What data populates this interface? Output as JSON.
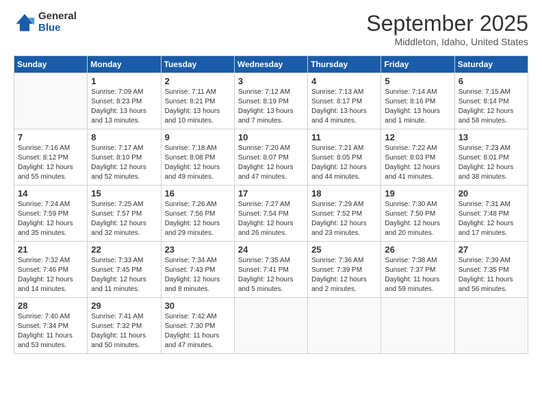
{
  "header": {
    "logo_general": "General",
    "logo_blue": "Blue",
    "month_title": "September 2025",
    "location": "Middleton, Idaho, United States"
  },
  "days_of_week": [
    "Sunday",
    "Monday",
    "Tuesday",
    "Wednesday",
    "Thursday",
    "Friday",
    "Saturday"
  ],
  "weeks": [
    [
      {
        "day": "",
        "info": ""
      },
      {
        "day": "1",
        "info": "Sunrise: 7:09 AM\nSunset: 8:23 PM\nDaylight: 13 hours\nand 13 minutes."
      },
      {
        "day": "2",
        "info": "Sunrise: 7:11 AM\nSunset: 8:21 PM\nDaylight: 13 hours\nand 10 minutes."
      },
      {
        "day": "3",
        "info": "Sunrise: 7:12 AM\nSunset: 8:19 PM\nDaylight: 13 hours\nand 7 minutes."
      },
      {
        "day": "4",
        "info": "Sunrise: 7:13 AM\nSunset: 8:17 PM\nDaylight: 13 hours\nand 4 minutes."
      },
      {
        "day": "5",
        "info": "Sunrise: 7:14 AM\nSunset: 8:16 PM\nDaylight: 13 hours\nand 1 minute."
      },
      {
        "day": "6",
        "info": "Sunrise: 7:15 AM\nSunset: 8:14 PM\nDaylight: 12 hours\nand 58 minutes."
      }
    ],
    [
      {
        "day": "7",
        "info": "Sunrise: 7:16 AM\nSunset: 8:12 PM\nDaylight: 12 hours\nand 55 minutes."
      },
      {
        "day": "8",
        "info": "Sunrise: 7:17 AM\nSunset: 8:10 PM\nDaylight: 12 hours\nand 52 minutes."
      },
      {
        "day": "9",
        "info": "Sunrise: 7:18 AM\nSunset: 8:08 PM\nDaylight: 12 hours\nand 49 minutes."
      },
      {
        "day": "10",
        "info": "Sunrise: 7:20 AM\nSunset: 8:07 PM\nDaylight: 12 hours\nand 47 minutes."
      },
      {
        "day": "11",
        "info": "Sunrise: 7:21 AM\nSunset: 8:05 PM\nDaylight: 12 hours\nand 44 minutes."
      },
      {
        "day": "12",
        "info": "Sunrise: 7:22 AM\nSunset: 8:03 PM\nDaylight: 12 hours\nand 41 minutes."
      },
      {
        "day": "13",
        "info": "Sunrise: 7:23 AM\nSunset: 8:01 PM\nDaylight: 12 hours\nand 38 minutes."
      }
    ],
    [
      {
        "day": "14",
        "info": "Sunrise: 7:24 AM\nSunset: 7:59 PM\nDaylight: 12 hours\nand 35 minutes."
      },
      {
        "day": "15",
        "info": "Sunrise: 7:25 AM\nSunset: 7:57 PM\nDaylight: 12 hours\nand 32 minutes."
      },
      {
        "day": "16",
        "info": "Sunrise: 7:26 AM\nSunset: 7:56 PM\nDaylight: 12 hours\nand 29 minutes."
      },
      {
        "day": "17",
        "info": "Sunrise: 7:27 AM\nSunset: 7:54 PM\nDaylight: 12 hours\nand 26 minutes."
      },
      {
        "day": "18",
        "info": "Sunrise: 7:29 AM\nSunset: 7:52 PM\nDaylight: 12 hours\nand 23 minutes."
      },
      {
        "day": "19",
        "info": "Sunrise: 7:30 AM\nSunset: 7:50 PM\nDaylight: 12 hours\nand 20 minutes."
      },
      {
        "day": "20",
        "info": "Sunrise: 7:31 AM\nSunset: 7:48 PM\nDaylight: 12 hours\nand 17 minutes."
      }
    ],
    [
      {
        "day": "21",
        "info": "Sunrise: 7:32 AM\nSunset: 7:46 PM\nDaylight: 12 hours\nand 14 minutes."
      },
      {
        "day": "22",
        "info": "Sunrise: 7:33 AM\nSunset: 7:45 PM\nDaylight: 12 hours\nand 11 minutes."
      },
      {
        "day": "23",
        "info": "Sunrise: 7:34 AM\nSunset: 7:43 PM\nDaylight: 12 hours\nand 8 minutes."
      },
      {
        "day": "24",
        "info": "Sunrise: 7:35 AM\nSunset: 7:41 PM\nDaylight: 12 hours\nand 5 minutes."
      },
      {
        "day": "25",
        "info": "Sunrise: 7:36 AM\nSunset: 7:39 PM\nDaylight: 12 hours\nand 2 minutes."
      },
      {
        "day": "26",
        "info": "Sunrise: 7:38 AM\nSunset: 7:37 PM\nDaylight: 11 hours\nand 59 minutes."
      },
      {
        "day": "27",
        "info": "Sunrise: 7:39 AM\nSunset: 7:35 PM\nDaylight: 11 hours\nand 56 minutes."
      }
    ],
    [
      {
        "day": "28",
        "info": "Sunrise: 7:40 AM\nSunset: 7:34 PM\nDaylight: 11 hours\nand 53 minutes."
      },
      {
        "day": "29",
        "info": "Sunrise: 7:41 AM\nSunset: 7:32 PM\nDaylight: 11 hours\nand 50 minutes."
      },
      {
        "day": "30",
        "info": "Sunrise: 7:42 AM\nSunset: 7:30 PM\nDaylight: 11 hours\nand 47 minutes."
      },
      {
        "day": "",
        "info": ""
      },
      {
        "day": "",
        "info": ""
      },
      {
        "day": "",
        "info": ""
      },
      {
        "day": "",
        "info": ""
      }
    ]
  ]
}
